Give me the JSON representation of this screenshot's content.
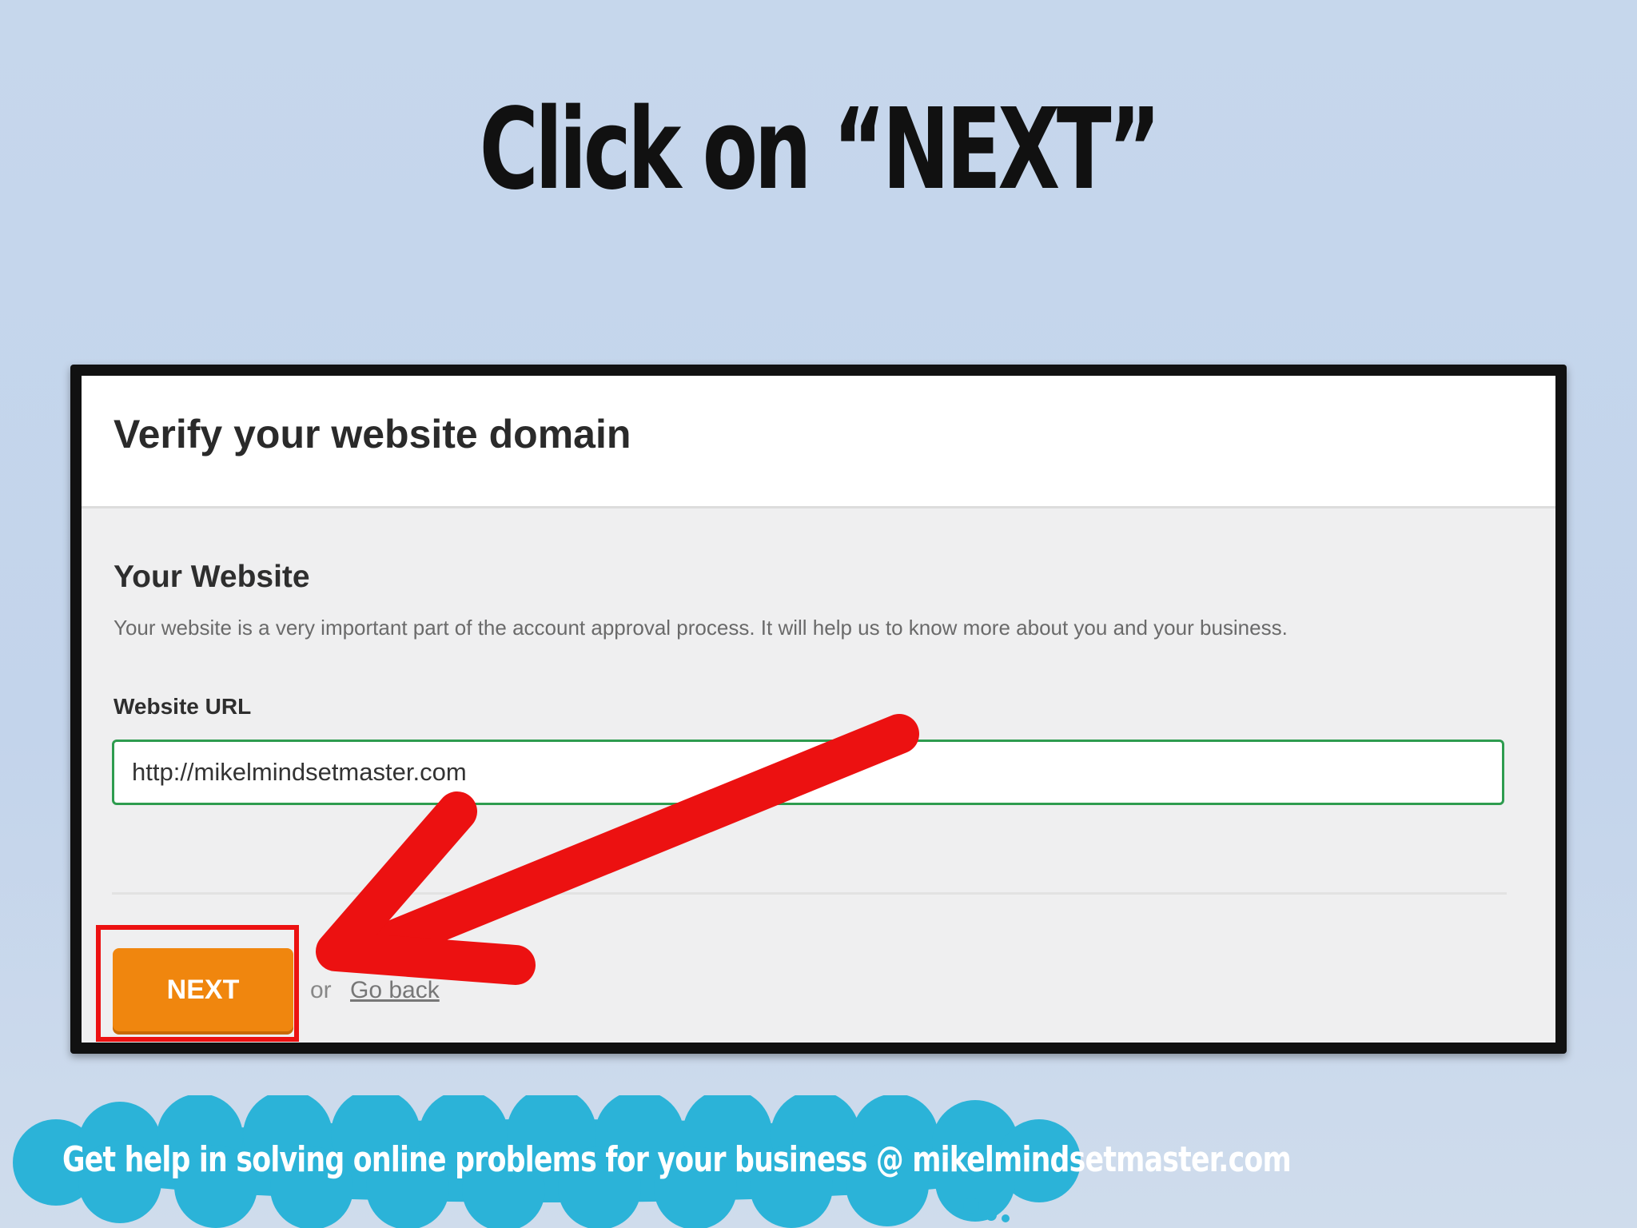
{
  "slide": {
    "title": "Click on “NEXT”"
  },
  "form": {
    "title": "Verify your website domain",
    "section_title": "Your Website",
    "section_description": "Your website is a very important part of the account approval process. It will help us to know more about you and your business.",
    "url_label": "Website URL",
    "url_value": "http://mikelmindsetmaster.com",
    "next_label": "NEXT",
    "or_text": "or",
    "go_back_label": "Go back"
  },
  "banner": {
    "text": "Get help in solving online problems for your business @ mikelmindsetmaster.com"
  },
  "colors": {
    "background": "#c6d7ec",
    "next_button": "#f0860e",
    "input_border": "#2e9c4f",
    "annotation_red": "#ec1111",
    "cloud": "#2bb3d8"
  },
  "icons": {
    "annotation_arrow": "red-arrow-icon",
    "cloud": "cloud-icon"
  }
}
